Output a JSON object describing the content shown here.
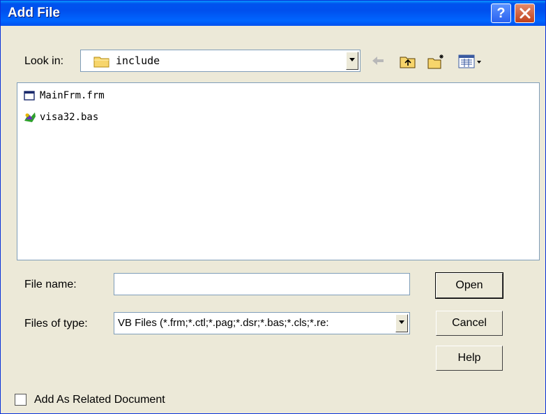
{
  "window": {
    "title": "Add File",
    "help_glyph": "?",
    "close_icon": "close-icon",
    "titlebar_color": "#0054e3"
  },
  "lookin": {
    "label": "Look in:",
    "value": "include"
  },
  "files": [
    {
      "name": "MainFrm.frm",
      "icon": "form-file-icon"
    },
    {
      "name": "visa32.bas",
      "icon": "module-file-icon"
    }
  ],
  "filename": {
    "label": "File name:",
    "value": ""
  },
  "filetype": {
    "label": "Files of type:",
    "value": "VB Files (*.frm;*.ctl;*.pag;*.dsr;*.bas;*.cls;*.re:"
  },
  "buttons": {
    "open": "Open",
    "cancel": "Cancel",
    "help": "Help"
  },
  "related": {
    "label": "Add As Related Document",
    "checked": false
  }
}
